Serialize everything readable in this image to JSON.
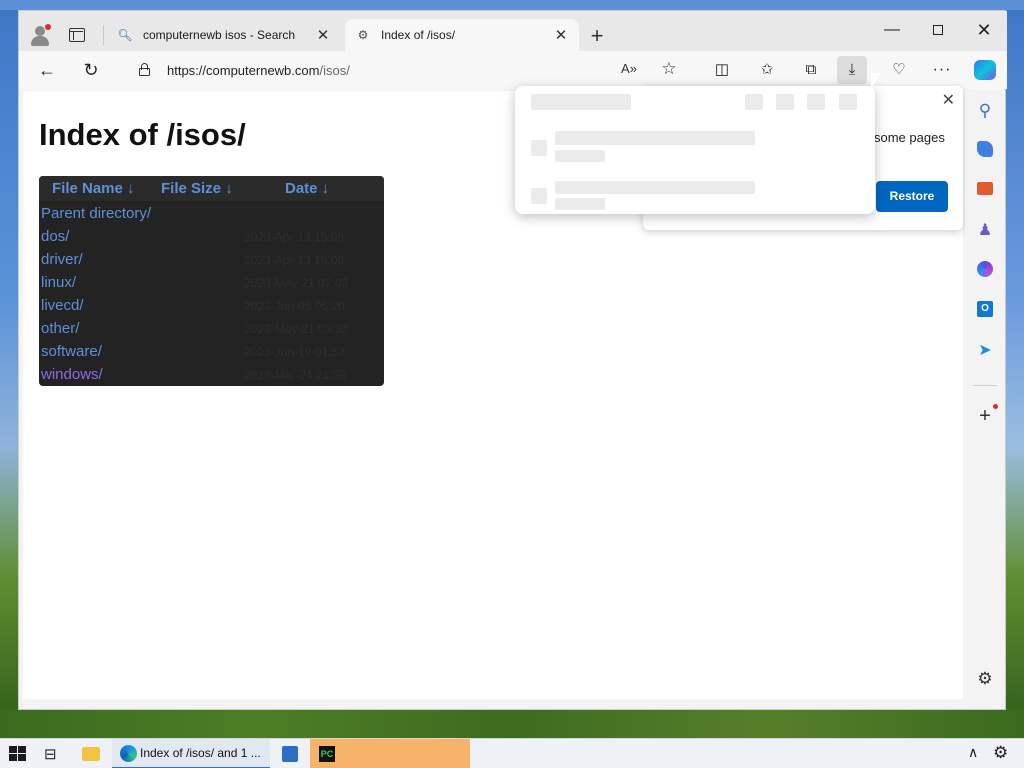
{
  "browser": {
    "tabs": [
      {
        "label": "computernewb isos - Search",
        "icon": "search-icon"
      },
      {
        "label": "Index of /isos/",
        "icon": "site-favicon",
        "active": true
      }
    ],
    "url_host": "https://computernewb.com",
    "url_path": "/isos/"
  },
  "page": {
    "title": "Index of /isos/",
    "columns": [
      "File Name  ↓",
      "File Size  ↓",
      "Date  ↓"
    ],
    "rows": [
      {
        "name": "Parent directory/",
        "size": "",
        "date": ""
      },
      {
        "name": "dos/",
        "size": "-",
        "date": "2023-Apr-13 15:08"
      },
      {
        "name": "driver/",
        "size": "-",
        "date": "2023-Apr-13 15:08"
      },
      {
        "name": "linux/",
        "size": "-",
        "date": "2023-May-21 02:03"
      },
      {
        "name": "livecd/",
        "size": "-",
        "date": "2023-Jun-05 05:20"
      },
      {
        "name": "other/",
        "size": "-",
        "date": "2023-May-21 05:32"
      },
      {
        "name": "software/",
        "size": "-",
        "date": "2023-Jun-19 01:52"
      },
      {
        "name": "windows/",
        "size": "-",
        "date": "2023-Mar-24 21:58"
      }
    ]
  },
  "restore_notice": {
    "text": "some pages",
    "button": "Restore"
  },
  "taskbar": {
    "edge_label": "Index of /isos/ and 1 ..."
  },
  "colors": {
    "link": "#5e8fdb",
    "visited_link": "#8b6ee0",
    "accent": "#0067c0",
    "highlight_task": "#f7b26a"
  }
}
